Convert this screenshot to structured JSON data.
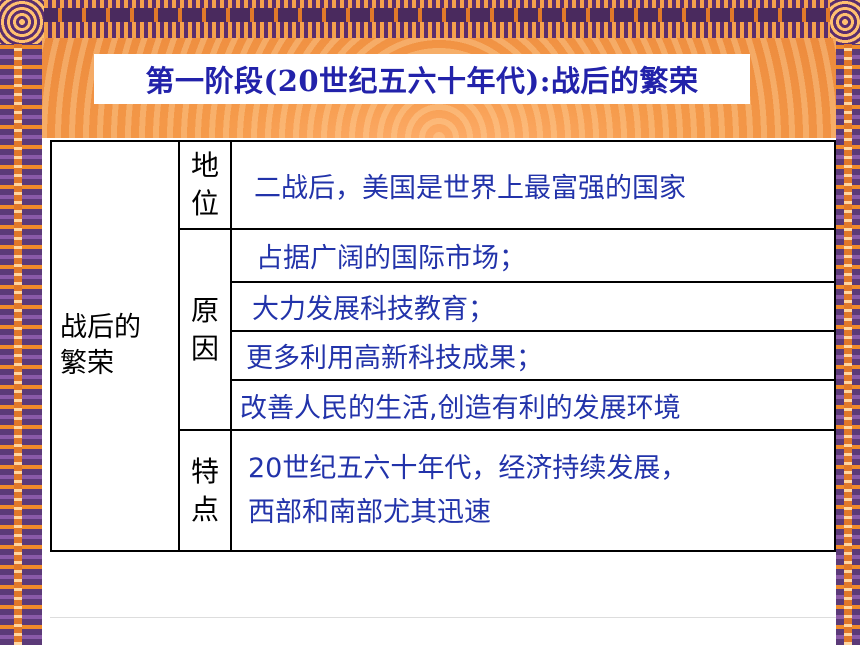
{
  "slide": {
    "title": "第一阶段(20世纪五六十年代):战后的繁荣",
    "colors": {
      "title_text": "#2222aa",
      "value_text": "#2233aa",
      "frame_orange": "#f2a25a",
      "frame_purple": "#5a2d6e"
    }
  },
  "table": {
    "category_lines": [
      "战后的",
      "繁荣"
    ],
    "rows": [
      {
        "label_lines": [
          "地",
          "位"
        ],
        "values": [
          "二战后，美国是世界上最富强的国家"
        ]
      },
      {
        "label_lines": [
          "原",
          "因"
        ],
        "values": [
          "占据广阔的国际市场；",
          "大力发展科技教育；",
          "更多利用高新科技成果；",
          "改善人民的生活,创造有利的发展环境"
        ]
      },
      {
        "label_lines": [
          "特",
          "点"
        ],
        "values": [
          "20世纪五六十年代，经济持续发展，",
          "西部和南部尤其迅速"
        ]
      }
    ]
  }
}
